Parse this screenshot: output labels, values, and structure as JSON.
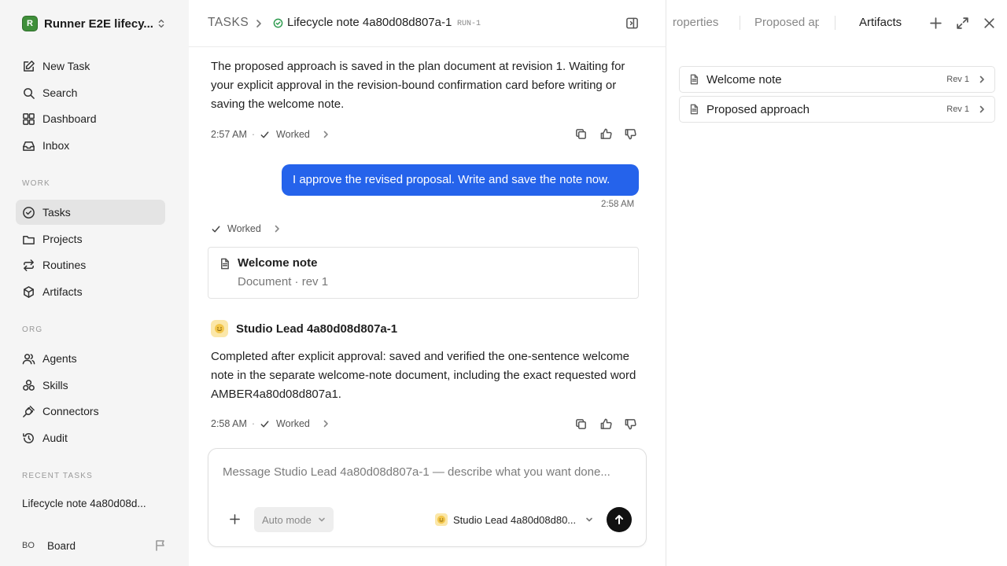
{
  "workspace": {
    "logo_letter": "R",
    "name": "Runner E2E lifecy..."
  },
  "nav": {
    "new_task": "New Task",
    "search": "Search",
    "dashboard": "Dashboard",
    "inbox": "Inbox",
    "work_label": "WORK",
    "tasks": "Tasks",
    "projects": "Projects",
    "routines": "Routines",
    "artifacts": "Artifacts",
    "org_label": "ORG",
    "agents": "Agents",
    "skills": "Skills",
    "connectors": "Connectors",
    "audit": "Audit",
    "recent_label": "RECENT TASKS",
    "recent_item": "Lifecycle note 4a80d08d..."
  },
  "user": {
    "initials": "BO",
    "name": "Board"
  },
  "header": {
    "root": "TASKS",
    "title": "Lifecycle note 4a80d08d807a-1",
    "run": "RUN-1",
    "status_color": "#2e9b4f"
  },
  "messages": {
    "first_text": "The proposed approach is saved in the plan document at revision 1. Waiting for your explicit approval in the revision-bound confirmation card before writing or saving the welcome note.",
    "first_time": "2:57 AM",
    "worked": "Worked",
    "user_text": "I approve the revised proposal. Write and save the note now.",
    "user_time": "2:58 AM",
    "doc_title": "Welcome note",
    "doc_sub": "Document · rev 1",
    "agent_name": "Studio Lead 4a80d08d807a-1",
    "agent_text": "Completed after explicit approval: saved and verified the one-sentence welcome note in the separate welcome-note document, including the exact requested word AMBER4a80d08d807a1.",
    "agent_time": "2:58 AM",
    "separator": "·"
  },
  "composer": {
    "placeholder": "Message Studio Lead 4a80d08d807a-1 — describe what you want done...",
    "value": "",
    "mode": "Auto mode",
    "agent": "Studio Lead 4a80d08d80..."
  },
  "right_panel": {
    "tabs": [
      "roperties",
      "Proposed ap",
      "Artifacts"
    ],
    "active_tab": "Artifacts",
    "artifacts": [
      {
        "title": "Welcome note",
        "rev": "Rev 1"
      },
      {
        "title": "Proposed approach",
        "rev": "Rev 1"
      }
    ]
  },
  "colors": {
    "accent": "#2563eb",
    "sidebar_bg": "#f5f5f5"
  }
}
